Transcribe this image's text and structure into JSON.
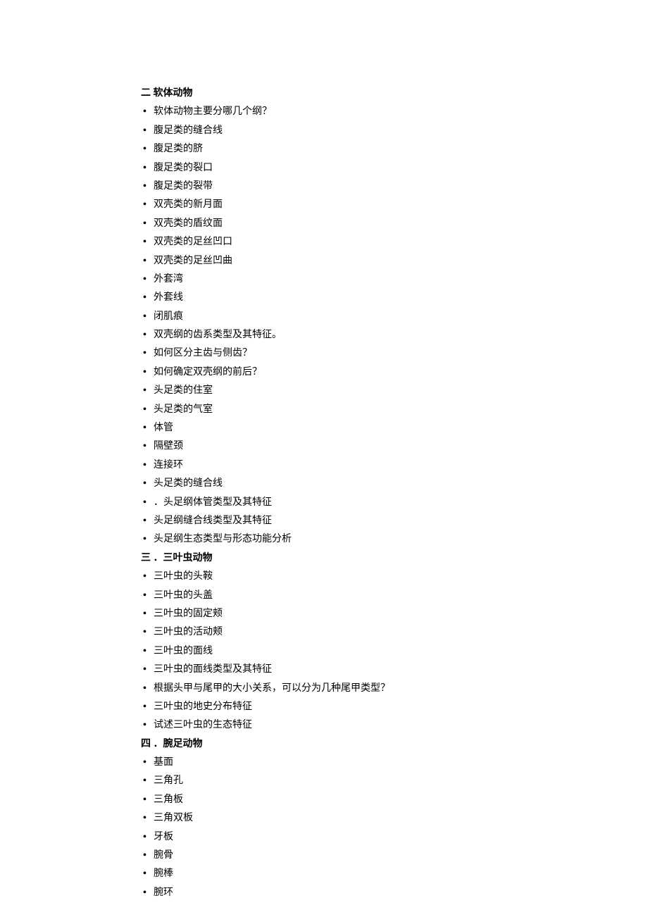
{
  "sections": [
    {
      "heading": "二  软体动物",
      "items": [
        "软体动物主要分哪几个纲？",
        "腹足类的缝合线",
        "腹足类的脐",
        "腹足类的裂口",
        "腹足类的裂带",
        "双壳类的新月面",
        "双壳类的盾纹面",
        "双壳类的足丝凹口",
        "双壳类的足丝凹曲",
        "外套湾",
        "外套线",
        "闭肌痕",
        "双壳纲的齿系类型及其特征。",
        "如何区分主齿与侧齿？",
        "如何确定双壳纲的前后？",
        "头足类的住室",
        "头足类的气室",
        "体管",
        "隔壁颈",
        "连接环",
        "头足类的缝合线",
        "．头足纲体管类型及其特征",
        "头足纲缝合线类型及其特征",
        "头足纲生态类型与形态功能分析"
      ]
    },
    {
      "heading": "三 ．三叶虫动物",
      "items": [
        "三叶虫的头鞍",
        "三叶虫的头盖",
        "三叶虫的固定颊",
        "三叶虫的活动颊",
        "三叶虫的面线",
        "三叶虫的面线类型及其特征",
        "根据头甲与尾甲的大小关系，可以分为几种尾甲类型？",
        "三叶虫的地史分布特征",
        "试述三叶虫的生态特征"
      ]
    },
    {
      "heading": "四 ．腕足动物",
      "items": [
        "基面",
        "三角孔",
        "三角板",
        "三角双板",
        "牙板",
        "腕骨",
        "腕棒",
        "腕环"
      ]
    }
  ]
}
